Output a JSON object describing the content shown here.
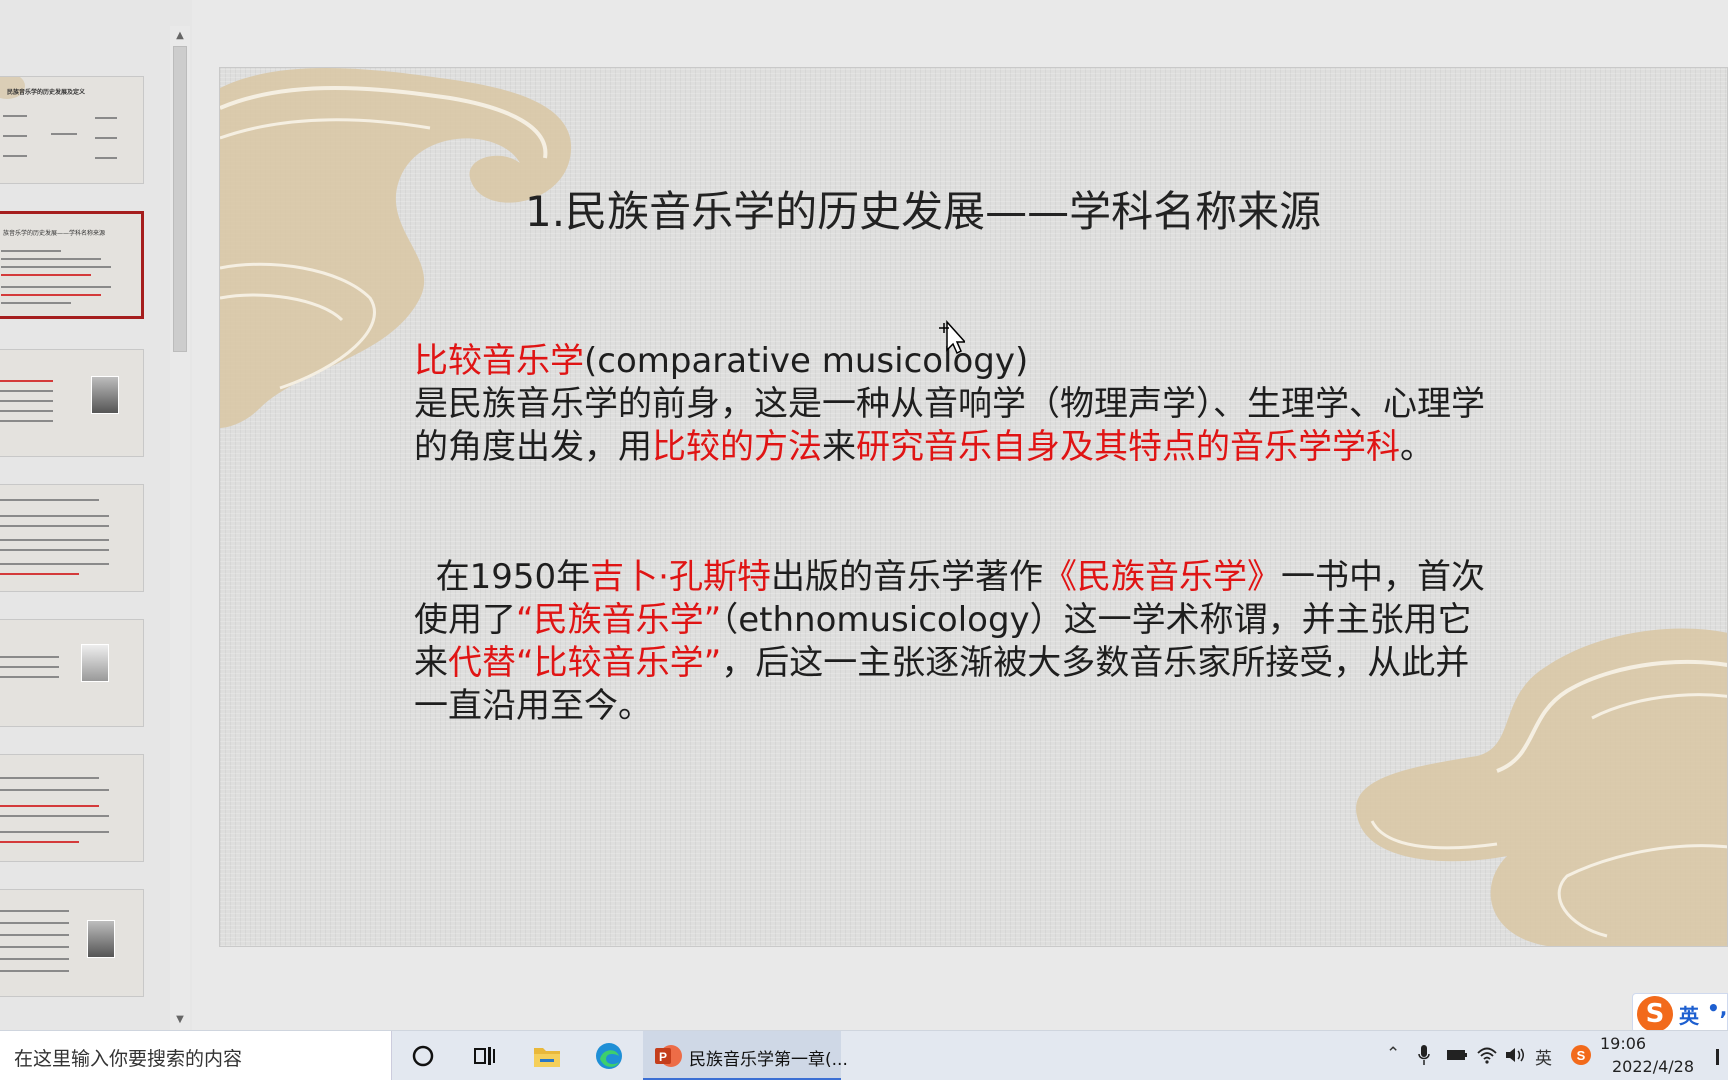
{
  "slide": {
    "title": "1.民族音乐学的历史发展——学科名称来源",
    "para1": {
      "term": "比较音乐学",
      "term_en": "(comparative musicology)",
      "line2a": " 是民族音乐学的前身，这是一种从音响学（物理声学）、生理学、心理学的角度出发，用",
      "method": "比较的方法",
      "lai": "来",
      "study": "研究音乐自身及其特点的音乐学学科",
      "end": "。"
    },
    "para2": {
      "a": "在1950年",
      "person": "吉卜·孔斯特",
      "b": "出版的音乐学著作",
      "book": "《民族音乐学》",
      "c": "一书中，首次使用了",
      "term": "“民族音乐学”",
      "d": "（ethnomusicology）这一学术称谓，并主张用它来",
      "replace": "代替“比较音乐学”",
      "e": "，后这一主张逐渐被大多数音乐家所接受，从此并一直沿用至今。"
    }
  },
  "thumbnails": {
    "t1_title": "民族音乐学的历史发展及定义",
    "t2_title": "族音乐学的历史发展——学科名称来源"
  },
  "ime": {
    "logo": "S",
    "mode": "英",
    "dots": "•,"
  },
  "taskbar": {
    "search_placeholder": "在这里输入你要搜索的内容",
    "ppt_app_label": "民族音乐学第一章(...",
    "ime_tray": "英",
    "time": "19:06",
    "date": "2022/4/28"
  },
  "colors": {
    "accent_red": "#e01414",
    "selected_border": "#a51d1d",
    "taskbar_accent": "#3b6fd4"
  }
}
